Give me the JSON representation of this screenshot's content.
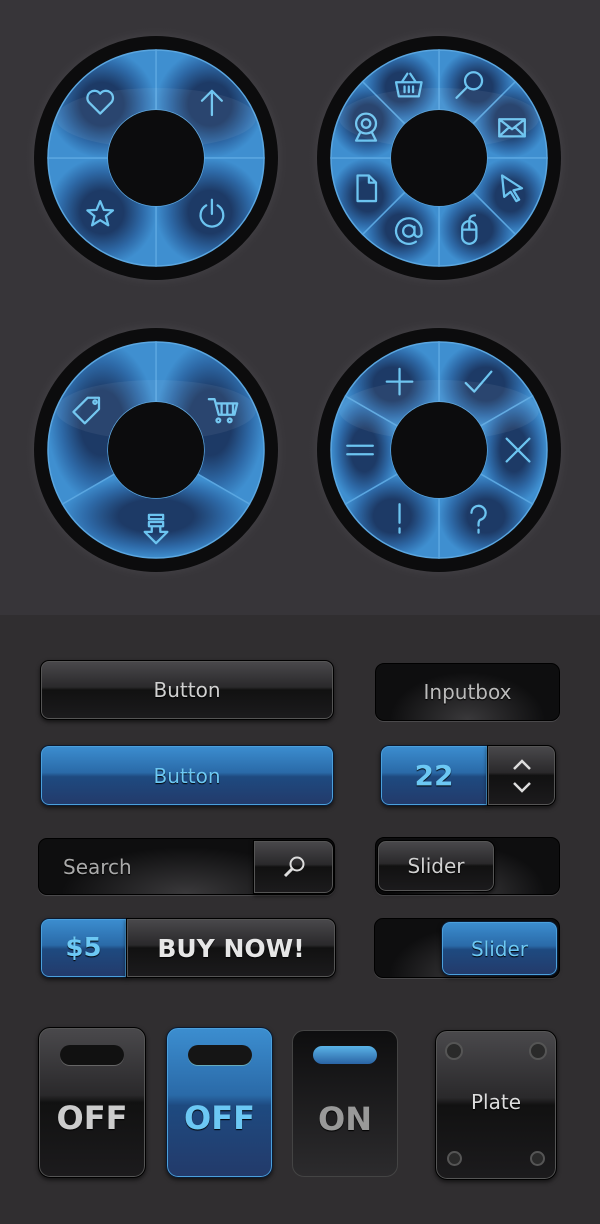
{
  "colors": {
    "accent": "#3a86c8",
    "icon": "#6cc4f0",
    "panel": "#373539"
  },
  "radial_menus": [
    {
      "name": "basic",
      "icons": [
        "arrow-up",
        "power",
        "star",
        "heart"
      ]
    },
    {
      "name": "tools",
      "icons": [
        "search",
        "mail",
        "cursor",
        "mouse",
        "at",
        "document",
        "webcam",
        "basket"
      ]
    },
    {
      "name": "shop",
      "icons": [
        "cart",
        "download",
        "tag"
      ]
    },
    {
      "name": "actions",
      "icons": [
        "check",
        "close",
        "question",
        "exclamation",
        "equals",
        "plus"
      ]
    }
  ],
  "controls": {
    "button_dark": "Button",
    "inputbox": "Inputbox",
    "button_blue": "Button",
    "stepper_value": "22",
    "search_placeholder": "Search",
    "slider1": "Slider",
    "slider1_position": 0,
    "price": "$5",
    "buy_now": "BUY NOW!",
    "slider2": "Slider",
    "slider2_position": 1,
    "toggle1": "OFF",
    "toggle2": "OFF",
    "toggle3": "ON",
    "plate": "Plate"
  }
}
